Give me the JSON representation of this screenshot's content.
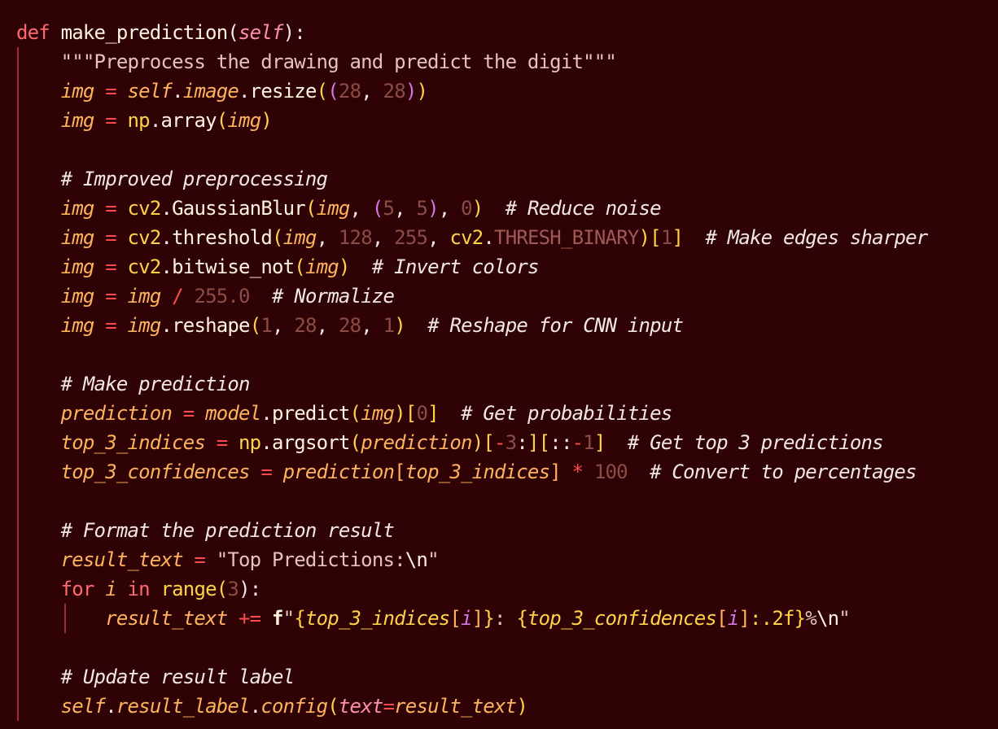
{
  "editor": {
    "language": "Python",
    "lines": [
      {
        "indent": 0,
        "tokens": [
          {
            "text": "def",
            "type": "kw"
          },
          {
            "text": " ",
            "type": "punc"
          },
          {
            "text": "make_prediction",
            "type": "fn"
          },
          {
            "text": "(",
            "type": "punc"
          },
          {
            "text": "self",
            "type": "param"
          },
          {
            "text": "):",
            "type": "punc"
          }
        ]
      },
      {
        "indent": 4,
        "tokens": [
          {
            "text": "\"\"\"Preprocess the drawing and predict the digit\"\"\"",
            "type": "doc"
          }
        ]
      },
      {
        "indent": 4,
        "tokens": [
          {
            "text": "img",
            "type": "var"
          },
          {
            "text": " ",
            "type": "punc"
          },
          {
            "text": "=",
            "type": "op"
          },
          {
            "text": " ",
            "type": "punc"
          },
          {
            "text": "self",
            "type": "self"
          },
          {
            "text": ".",
            "type": "punc"
          },
          {
            "text": "image",
            "type": "attr"
          },
          {
            "text": ".",
            "type": "punc"
          },
          {
            "text": "resize",
            "type": "method"
          },
          {
            "text": "(",
            "type": "paren"
          },
          {
            "text": "(",
            "type": "paren2"
          },
          {
            "text": "28",
            "type": "num"
          },
          {
            "text": ", ",
            "type": "punc"
          },
          {
            "text": "28",
            "type": "num"
          },
          {
            "text": ")",
            "type": "paren2"
          },
          {
            "text": ")",
            "type": "paren"
          }
        ]
      },
      {
        "indent": 4,
        "tokens": [
          {
            "text": "img",
            "type": "var"
          },
          {
            "text": " ",
            "type": "punc"
          },
          {
            "text": "=",
            "type": "op"
          },
          {
            "text": " ",
            "type": "punc"
          },
          {
            "text": "np",
            "type": "module"
          },
          {
            "text": ".",
            "type": "punc"
          },
          {
            "text": "array",
            "type": "method"
          },
          {
            "text": "(",
            "type": "paren"
          },
          {
            "text": "img",
            "type": "var"
          },
          {
            "text": ")",
            "type": "paren"
          }
        ]
      },
      {
        "indent": 0,
        "tokens": []
      },
      {
        "indent": 4,
        "tokens": [
          {
            "text": "# Improved preprocessing",
            "type": "comment"
          }
        ]
      },
      {
        "indent": 4,
        "tokens": [
          {
            "text": "img",
            "type": "var"
          },
          {
            "text": " ",
            "type": "punc"
          },
          {
            "text": "=",
            "type": "op"
          },
          {
            "text": " ",
            "type": "punc"
          },
          {
            "text": "cv2",
            "type": "module"
          },
          {
            "text": ".",
            "type": "punc"
          },
          {
            "text": "GaussianBlur",
            "type": "method"
          },
          {
            "text": "(",
            "type": "paren"
          },
          {
            "text": "img",
            "type": "var"
          },
          {
            "text": ", ",
            "type": "punc"
          },
          {
            "text": "(",
            "type": "paren2"
          },
          {
            "text": "5",
            "type": "num"
          },
          {
            "text": ", ",
            "type": "punc"
          },
          {
            "text": "5",
            "type": "num"
          },
          {
            "text": ")",
            "type": "paren2"
          },
          {
            "text": ", ",
            "type": "punc"
          },
          {
            "text": "0",
            "type": "num"
          },
          {
            "text": ")",
            "type": "paren"
          },
          {
            "text": "  ",
            "type": "punc"
          },
          {
            "text": "# Reduce noise",
            "type": "comment"
          }
        ]
      },
      {
        "indent": 4,
        "tokens": [
          {
            "text": "img",
            "type": "var"
          },
          {
            "text": " ",
            "type": "punc"
          },
          {
            "text": "=",
            "type": "op"
          },
          {
            "text": " ",
            "type": "punc"
          },
          {
            "text": "cv2",
            "type": "module"
          },
          {
            "text": ".",
            "type": "punc"
          },
          {
            "text": "threshold",
            "type": "method"
          },
          {
            "text": "(",
            "type": "paren"
          },
          {
            "text": "img",
            "type": "var"
          },
          {
            "text": ", ",
            "type": "punc"
          },
          {
            "text": "128",
            "type": "num"
          },
          {
            "text": ", ",
            "type": "punc"
          },
          {
            "text": "255",
            "type": "num"
          },
          {
            "text": ", ",
            "type": "punc"
          },
          {
            "text": "cv2",
            "type": "module"
          },
          {
            "text": ".",
            "type": "punc"
          },
          {
            "text": "THRESH_BINARY",
            "type": "const"
          },
          {
            "text": ")",
            "type": "paren"
          },
          {
            "text": "[",
            "type": "paren"
          },
          {
            "text": "1",
            "type": "num"
          },
          {
            "text": "]",
            "type": "paren"
          },
          {
            "text": "  ",
            "type": "punc"
          },
          {
            "text": "# Make edges sharper",
            "type": "comment"
          }
        ]
      },
      {
        "indent": 4,
        "tokens": [
          {
            "text": "img",
            "type": "var"
          },
          {
            "text": " ",
            "type": "punc"
          },
          {
            "text": "=",
            "type": "op"
          },
          {
            "text": " ",
            "type": "punc"
          },
          {
            "text": "cv2",
            "type": "module"
          },
          {
            "text": ".",
            "type": "punc"
          },
          {
            "text": "bitwise_not",
            "type": "method"
          },
          {
            "text": "(",
            "type": "paren"
          },
          {
            "text": "img",
            "type": "var"
          },
          {
            "text": ")",
            "type": "paren"
          },
          {
            "text": "  ",
            "type": "punc"
          },
          {
            "text": "# Invert colors",
            "type": "comment"
          }
        ]
      },
      {
        "indent": 4,
        "tokens": [
          {
            "text": "img",
            "type": "var"
          },
          {
            "text": " ",
            "type": "punc"
          },
          {
            "text": "=",
            "type": "op"
          },
          {
            "text": " ",
            "type": "punc"
          },
          {
            "text": "img",
            "type": "var"
          },
          {
            "text": " ",
            "type": "punc"
          },
          {
            "text": "/",
            "type": "op"
          },
          {
            "text": " ",
            "type": "punc"
          },
          {
            "text": "255.0",
            "type": "num"
          },
          {
            "text": "  ",
            "type": "punc"
          },
          {
            "text": "# Normalize",
            "type": "comment"
          }
        ]
      },
      {
        "indent": 4,
        "tokens": [
          {
            "text": "img",
            "type": "var"
          },
          {
            "text": " ",
            "type": "punc"
          },
          {
            "text": "=",
            "type": "op"
          },
          {
            "text": " ",
            "type": "punc"
          },
          {
            "text": "img",
            "type": "var"
          },
          {
            "text": ".",
            "type": "punc"
          },
          {
            "text": "reshape",
            "type": "method"
          },
          {
            "text": "(",
            "type": "paren"
          },
          {
            "text": "1",
            "type": "num"
          },
          {
            "text": ", ",
            "type": "punc"
          },
          {
            "text": "28",
            "type": "num"
          },
          {
            "text": ", ",
            "type": "punc"
          },
          {
            "text": "28",
            "type": "num"
          },
          {
            "text": ", ",
            "type": "punc"
          },
          {
            "text": "1",
            "type": "num"
          },
          {
            "text": ")",
            "type": "paren"
          },
          {
            "text": "  ",
            "type": "punc"
          },
          {
            "text": "# Reshape for CNN input",
            "type": "comment"
          }
        ]
      },
      {
        "indent": 0,
        "tokens": []
      },
      {
        "indent": 4,
        "tokens": [
          {
            "text": "# Make prediction",
            "type": "comment"
          }
        ]
      },
      {
        "indent": 4,
        "tokens": [
          {
            "text": "prediction",
            "type": "var"
          },
          {
            "text": " ",
            "type": "punc"
          },
          {
            "text": "=",
            "type": "op"
          },
          {
            "text": " ",
            "type": "punc"
          },
          {
            "text": "model",
            "type": "var"
          },
          {
            "text": ".",
            "type": "punc"
          },
          {
            "text": "predict",
            "type": "method"
          },
          {
            "text": "(",
            "type": "paren"
          },
          {
            "text": "img",
            "type": "var"
          },
          {
            "text": ")",
            "type": "paren"
          },
          {
            "text": "[",
            "type": "paren"
          },
          {
            "text": "0",
            "type": "num"
          },
          {
            "text": "]",
            "type": "paren"
          },
          {
            "text": "  ",
            "type": "punc"
          },
          {
            "text": "# Get probabilities",
            "type": "comment"
          }
        ]
      },
      {
        "indent": 4,
        "tokens": [
          {
            "text": "top_3_indices",
            "type": "var"
          },
          {
            "text": " ",
            "type": "punc"
          },
          {
            "text": "=",
            "type": "op"
          },
          {
            "text": " ",
            "type": "punc"
          },
          {
            "text": "np",
            "type": "module"
          },
          {
            "text": ".",
            "type": "punc"
          },
          {
            "text": "argsort",
            "type": "method"
          },
          {
            "text": "(",
            "type": "paren"
          },
          {
            "text": "prediction",
            "type": "var"
          },
          {
            "text": ")",
            "type": "paren"
          },
          {
            "text": "[",
            "type": "paren"
          },
          {
            "text": "-",
            "type": "op"
          },
          {
            "text": "3",
            "type": "num"
          },
          {
            "text": ":",
            "type": "punc"
          },
          {
            "text": "]",
            "type": "paren"
          },
          {
            "text": "[",
            "type": "paren"
          },
          {
            "text": "::",
            "type": "punc"
          },
          {
            "text": "-",
            "type": "op"
          },
          {
            "text": "1",
            "type": "num"
          },
          {
            "text": "]",
            "type": "paren"
          },
          {
            "text": "  ",
            "type": "punc"
          },
          {
            "text": "# Get top 3 predictions",
            "type": "comment"
          }
        ]
      },
      {
        "indent": 4,
        "tokens": [
          {
            "text": "top_3_confidences",
            "type": "var"
          },
          {
            "text": " ",
            "type": "punc"
          },
          {
            "text": "=",
            "type": "op"
          },
          {
            "text": " ",
            "type": "punc"
          },
          {
            "text": "prediction",
            "type": "var"
          },
          {
            "text": "[",
            "type": "bracket"
          },
          {
            "text": "top_3_indices",
            "type": "var"
          },
          {
            "text": "]",
            "type": "bracket"
          },
          {
            "text": " ",
            "type": "punc"
          },
          {
            "text": "*",
            "type": "op"
          },
          {
            "text": " ",
            "type": "punc"
          },
          {
            "text": "100",
            "type": "num"
          },
          {
            "text": "  ",
            "type": "punc"
          },
          {
            "text": "# Convert to percentages",
            "type": "comment"
          }
        ]
      },
      {
        "indent": 0,
        "tokens": []
      },
      {
        "indent": 4,
        "tokens": [
          {
            "text": "# Format the prediction result",
            "type": "comment"
          }
        ]
      },
      {
        "indent": 4,
        "tokens": [
          {
            "text": "result_text",
            "type": "var"
          },
          {
            "text": " ",
            "type": "punc"
          },
          {
            "text": "=",
            "type": "op"
          },
          {
            "text": " ",
            "type": "punc"
          },
          {
            "text": "\"Top Predictions:",
            "type": "str"
          },
          {
            "text": "\\n",
            "type": "esc"
          },
          {
            "text": "\"",
            "type": "str"
          }
        ]
      },
      {
        "indent": 4,
        "tokens": [
          {
            "text": "for",
            "type": "kw"
          },
          {
            "text": " ",
            "type": "punc"
          },
          {
            "text": "i",
            "type": "var"
          },
          {
            "text": " ",
            "type": "punc"
          },
          {
            "text": "in",
            "type": "kw"
          },
          {
            "text": " ",
            "type": "punc"
          },
          {
            "text": "range",
            "type": "module"
          },
          {
            "text": "(",
            "type": "paren"
          },
          {
            "text": "3",
            "type": "num"
          },
          {
            "text": "):",
            "type": "punc"
          }
        ]
      },
      {
        "indent": 8,
        "tokens": [
          {
            "text": "result_text",
            "type": "var"
          },
          {
            "text": " ",
            "type": "punc"
          },
          {
            "text": "+=",
            "type": "op"
          },
          {
            "text": " ",
            "type": "punc"
          },
          {
            "text": "f",
            "type": "strf"
          },
          {
            "text": "\"",
            "type": "str"
          },
          {
            "text": "{",
            "type": "fmt"
          },
          {
            "text": "top_3_indices",
            "type": "inter"
          },
          {
            "text": "[",
            "type": "bracket"
          },
          {
            "text": "i",
            "type": "index"
          },
          {
            "text": "]",
            "type": "bracket"
          },
          {
            "text": "}",
            "type": "fmt"
          },
          {
            "text": ": ",
            "type": "str"
          },
          {
            "text": "{",
            "type": "fmt"
          },
          {
            "text": "top_3_confidences",
            "type": "inter"
          },
          {
            "text": "[",
            "type": "bracket"
          },
          {
            "text": "i",
            "type": "index"
          },
          {
            "text": "]",
            "type": "bracket"
          },
          {
            "text": ":.2f",
            "type": "fmt"
          },
          {
            "text": "}",
            "type": "fmt"
          },
          {
            "text": "%",
            "type": "str"
          },
          {
            "text": "\\n",
            "type": "esc"
          },
          {
            "text": "\"",
            "type": "str"
          }
        ]
      },
      {
        "indent": 0,
        "tokens": []
      },
      {
        "indent": 4,
        "tokens": [
          {
            "text": "# Update result label",
            "type": "comment"
          }
        ]
      },
      {
        "indent": 4,
        "tokens": [
          {
            "text": "self",
            "type": "self"
          },
          {
            "text": ".",
            "type": "punc"
          },
          {
            "text": "result_label",
            "type": "attr"
          },
          {
            "text": ".",
            "type": "punc"
          },
          {
            "text": "config",
            "type": "attr"
          },
          {
            "text": "(",
            "type": "paren"
          },
          {
            "text": "text",
            "type": "param"
          },
          {
            "text": "=",
            "type": "op"
          },
          {
            "text": "result_text",
            "type": "var"
          },
          {
            "text": ")",
            "type": "paren"
          }
        ]
      }
    ]
  }
}
